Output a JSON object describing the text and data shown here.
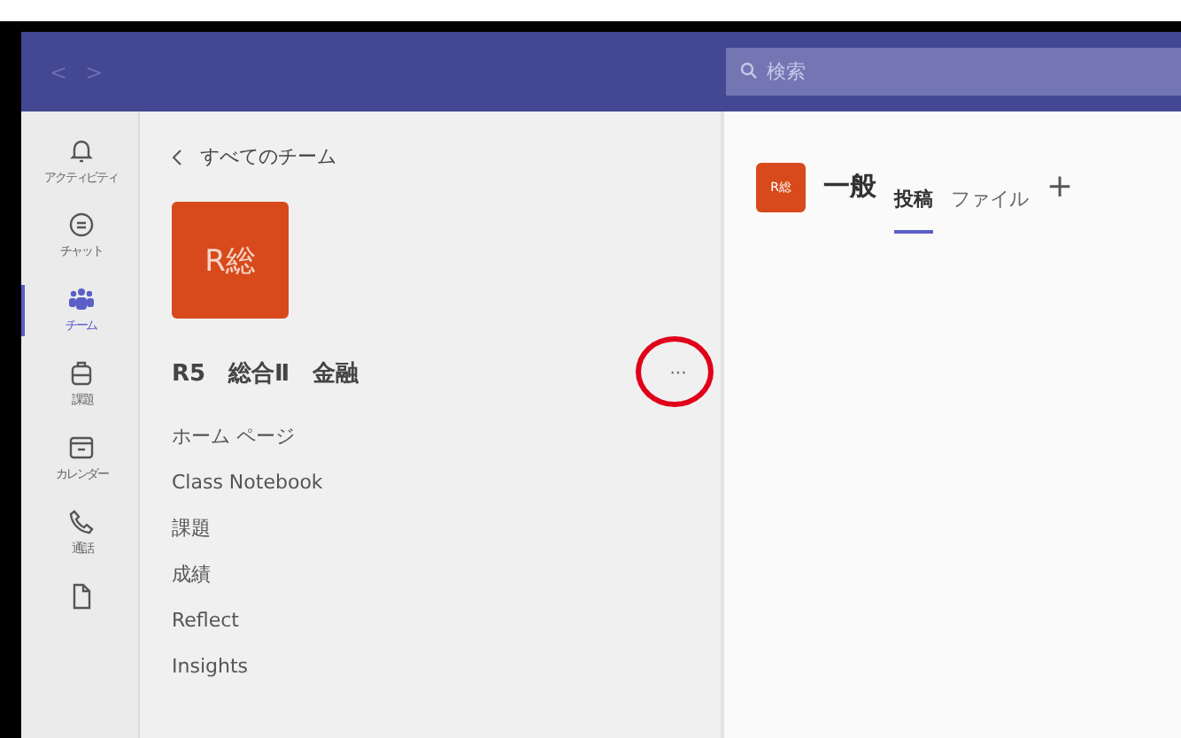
{
  "top_bar": {
    "back": "<",
    "forward": ">",
    "search": {
      "placeholder": "検索"
    }
  },
  "rail": [
    {
      "kind": "bell",
      "label": "アクティビティ",
      "selected": false
    },
    {
      "kind": "chat",
      "label": "チャット",
      "selected": false
    },
    {
      "kind": "team",
      "label": "チーム",
      "selected": true
    },
    {
      "kind": "bag",
      "label": "課題",
      "selected": false
    },
    {
      "kind": "calendar",
      "label": "カレンダー",
      "selected": false
    },
    {
      "kind": "phone",
      "label": "通話",
      "selected": false
    },
    {
      "kind": "file",
      "selected": false
    }
  ],
  "team_pane": {
    "back_link": "すべてのチーム",
    "avatar": "R総",
    "name": "R5　総合Ⅱ　金融",
    "more": "···",
    "items": [
      "ホーム ページ",
      "Class Notebook",
      "課題",
      "成績",
      "Reflect",
      "Insights"
    ]
  },
  "channel": {
    "avatar": "R総",
    "name": "一般",
    "tabs": [
      {
        "label": "投稿",
        "selected": true
      },
      {
        "label": "ファイル",
        "selected": false
      }
    ],
    "add": "+"
  }
}
